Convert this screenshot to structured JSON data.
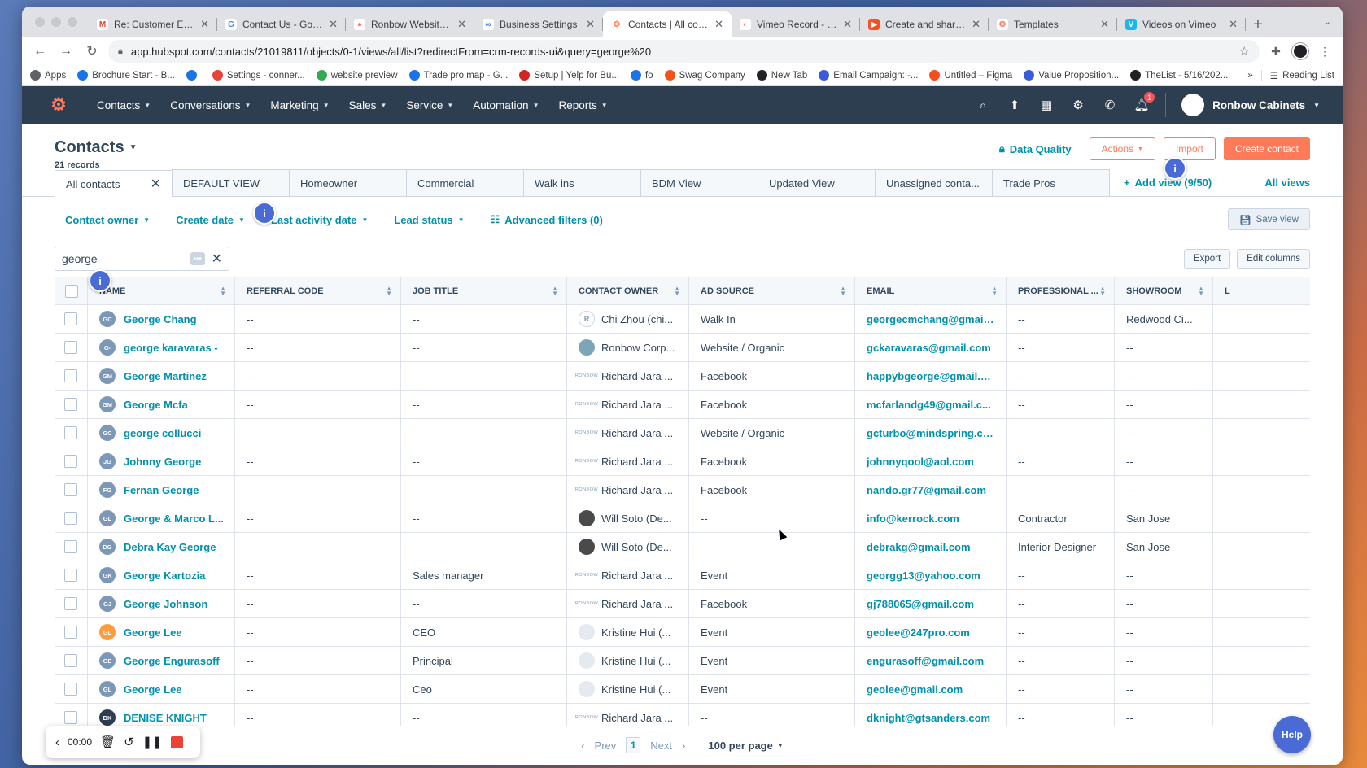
{
  "browser": {
    "tabs": [
      {
        "title": "Re: Customer Experi",
        "fav": "M",
        "fav_color": "#ea4335",
        "fav_bg": "#ffffff"
      },
      {
        "title": "Contact Us - Google",
        "fav": "G",
        "fav_color": "#4285f4",
        "fav_bg": "#ffffff"
      },
      {
        "title": "Ronbow Website 2",
        "fav": "●",
        "fav_color": "#ff7a59",
        "fav_bg": "#ffffff"
      },
      {
        "title": "Business Settings",
        "fav": "∞",
        "fav_color": "#1877f2",
        "fav_bg": "#ffffff"
      },
      {
        "title": "Contacts | All contac",
        "fav": "⚙",
        "fav_color": "#ff7a59",
        "fav_bg": "#ffffff",
        "active": true
      },
      {
        "title": "Vimeo Record - Scre",
        "fav": "◐",
        "fav_color": "#ff7a59",
        "fav_bg": "#ffffff"
      },
      {
        "title": "Create and share qu",
        "fav": "▶",
        "fav_color": "#ffffff",
        "fav_bg": "#f4511e"
      },
      {
        "title": "Templates",
        "fav": "⚙",
        "fav_color": "#ff7a59",
        "fav_bg": "#ffffff"
      },
      {
        "title": "Videos on Vimeo",
        "fav": "V",
        "fav_color": "#ffffff",
        "fav_bg": "#1ab7ea"
      }
    ],
    "url": "app.hubspot.com/contacts/21019811/objects/0-1/views/all/list?redirectFrom=crm-records-ui&query=george%20",
    "bookmarks": [
      {
        "label": "Apps",
        "color": "#5f6368"
      },
      {
        "label": "Brochure Start - B...",
        "color": "#1a73e8"
      },
      {
        "label": "",
        "color": "#1a73e8"
      },
      {
        "label": "Settings - conner...",
        "color": "#ea4335"
      },
      {
        "label": "website preview",
        "color": "#34a853"
      },
      {
        "label": "Trade pro map - G...",
        "color": "#1a73e8"
      },
      {
        "label": "Setup | Yelp for Bu...",
        "color": "#d32323"
      },
      {
        "label": "fo",
        "color": "#1a73e8"
      },
      {
        "label": "Swag Company",
        "color": "#f4511e"
      },
      {
        "label": "New Tab",
        "color": "#202124"
      },
      {
        "label": "Email Campaign: -...",
        "color": "#3b5bdb"
      },
      {
        "label": "Untitled – Figma",
        "color": "#f24e1e"
      },
      {
        "label": "Value Proposition...",
        "color": "#3b5bdb"
      },
      {
        "label": "TheList - 5/16/202...",
        "color": "#202124"
      }
    ],
    "bookmarks_more": "»",
    "reading_list": "Reading List"
  },
  "nav": {
    "menu": [
      "Contacts",
      "Conversations",
      "Marketing",
      "Sales",
      "Service",
      "Automation",
      "Reports"
    ],
    "notification_count": "1",
    "account": "Ronbow Cabinets"
  },
  "header": {
    "title": "Contacts",
    "records": "21 records",
    "data_quality": "Data Quality",
    "actions": "Actions",
    "import": "Import",
    "create": "Create contact"
  },
  "views": {
    "tabs": [
      "All contacts",
      "DEFAULT VIEW",
      "Homeowner",
      "Commercial",
      "Walk ins",
      "BDM View",
      "Updated View",
      "Unassigned conta...",
      "Trade Pros"
    ],
    "add_view": "Add view (9/50)",
    "all_views": "All views"
  },
  "filters": {
    "items": [
      "Contact owner",
      "Create date",
      "Last activity date",
      "Lead status"
    ],
    "advanced": "Advanced filters (0)",
    "save_view": "Save view"
  },
  "search": {
    "value": "george",
    "export": "Export",
    "edit_columns": "Edit columns"
  },
  "table": {
    "columns": [
      "Name",
      "Referral Code",
      "Job Title",
      "Contact Owner",
      "Ad Source",
      "Email",
      "Professional ...",
      "Showroom",
      "L"
    ],
    "rows": [
      {
        "initials": "GC",
        "name": "George Chang",
        "referral": "--",
        "job": "--",
        "owner": "Chi Zhou (chi...",
        "owner_type": "logo",
        "source": "Walk In",
        "email": "georgecmchang@gmail...",
        "professional": "--",
        "showroom": "Redwood Ci..."
      },
      {
        "initials": "G-",
        "name": "george karavaras -",
        "referral": "--",
        "job": "--",
        "owner": "Ronbow Corp...",
        "owner_type": "corp",
        "source": "Website / Organic",
        "email": "gckaravaras@gmail.com",
        "professional": "--",
        "showroom": "--"
      },
      {
        "initials": "GM",
        "name": "George Martinez",
        "referral": "--",
        "job": "--",
        "owner": "Richard Jara ...",
        "owner_type": "text",
        "source": "Facebook",
        "email": "happybgeorge@gmail.c...",
        "professional": "--",
        "showroom": "--"
      },
      {
        "initials": "GM",
        "name": "George Mcfa",
        "referral": "--",
        "job": "--",
        "owner": "Richard Jara ...",
        "owner_type": "text",
        "source": "Facebook",
        "email": "mcfarlandg49@gmail.c...",
        "professional": "--",
        "showroom": "--"
      },
      {
        "initials": "GC",
        "name": "george collucci",
        "referral": "--",
        "job": "--",
        "owner": "Richard Jara ...",
        "owner_type": "text",
        "source": "Website / Organic",
        "email": "gcturbo@mindspring.co...",
        "professional": "--",
        "showroom": "--"
      },
      {
        "initials": "JG",
        "name": "Johnny George",
        "referral": "--",
        "job": "--",
        "owner": "Richard Jara ...",
        "owner_type": "text",
        "source": "Facebook",
        "email": "johnnyqool@aol.com",
        "professional": "--",
        "showroom": "--"
      },
      {
        "initials": "FG",
        "name": "Fernan George",
        "referral": "--",
        "job": "--",
        "owner": "Richard Jara ...",
        "owner_type": "text",
        "source": "Facebook",
        "email": "nando.gr77@gmail.com",
        "professional": "--",
        "showroom": "--"
      },
      {
        "initials": "GL",
        "name": "George & Marco L...",
        "referral": "--",
        "job": "--",
        "owner": "Will Soto (De...",
        "owner_type": "photo",
        "source": "--",
        "email": "info@kerrock.com",
        "professional": "Contractor",
        "showroom": "San Jose"
      },
      {
        "initials": "DG",
        "name": "Debra Kay George",
        "referral": "--",
        "job": "--",
        "owner": "Will Soto (De...",
        "owner_type": "photo",
        "source": "--",
        "email": "debrakg@gmail.com",
        "professional": "Interior Designer",
        "showroom": "San Jose"
      },
      {
        "initials": "GK",
        "name": "George Kartozia",
        "referral": "--",
        "job": "Sales manager",
        "owner": "Richard Jara ...",
        "owner_type": "text",
        "source": "Event",
        "email": "georgg13@yahoo.com",
        "professional": "--",
        "showroom": "--"
      },
      {
        "initials": "GJ",
        "name": "George Johnson",
        "referral": "--",
        "job": "--",
        "owner": "Richard Jara ...",
        "owner_type": "text",
        "source": "Facebook",
        "email": "gj788065@gmail.com",
        "professional": "--",
        "showroom": "--"
      },
      {
        "initials": "GL",
        "name": "George Lee",
        "referral": "--",
        "job": "CEO",
        "owner": "Kristine Hui (...",
        "owner_type": "blank",
        "source": "Event",
        "email": "geolee@247pro.com",
        "professional": "--",
        "showroom": "--",
        "avatar_style": "org"
      },
      {
        "initials": "GE",
        "name": "George Engurasoff",
        "referral": "--",
        "job": "Principal",
        "owner": "Kristine Hui (...",
        "owner_type": "blank",
        "source": "Event",
        "email": "engurasoff@gmail.com",
        "professional": "--",
        "showroom": "--"
      },
      {
        "initials": "GL",
        "name": "George Lee",
        "referral": "--",
        "job": "Ceo",
        "owner": "Kristine Hui (...",
        "owner_type": "blank",
        "source": "Event",
        "email": "geolee@gmail.com",
        "professional": "--",
        "showroom": "--"
      },
      {
        "initials": "DK",
        "name": "DENISE KNIGHT",
        "referral": "--",
        "job": "--",
        "owner": "Richard Jara ...",
        "owner_type": "text",
        "source": "--",
        "email": "dknight@gtsanders.com",
        "professional": "--",
        "showroom": "--",
        "avatar_style": "dark"
      }
    ]
  },
  "pagination": {
    "prev": "Prev",
    "current": "1",
    "next": "Next",
    "per_page": "100 per page"
  },
  "recorder": {
    "time": "00:00"
  },
  "help": "Help",
  "hint_glyph": "i",
  "owner_text_logo": "RONBOW",
  "colors": {
    "hubspot_nav": "#2d3e50",
    "accent": "#ff7a59",
    "link": "#0091ae",
    "hint": "#4a6bd6"
  }
}
